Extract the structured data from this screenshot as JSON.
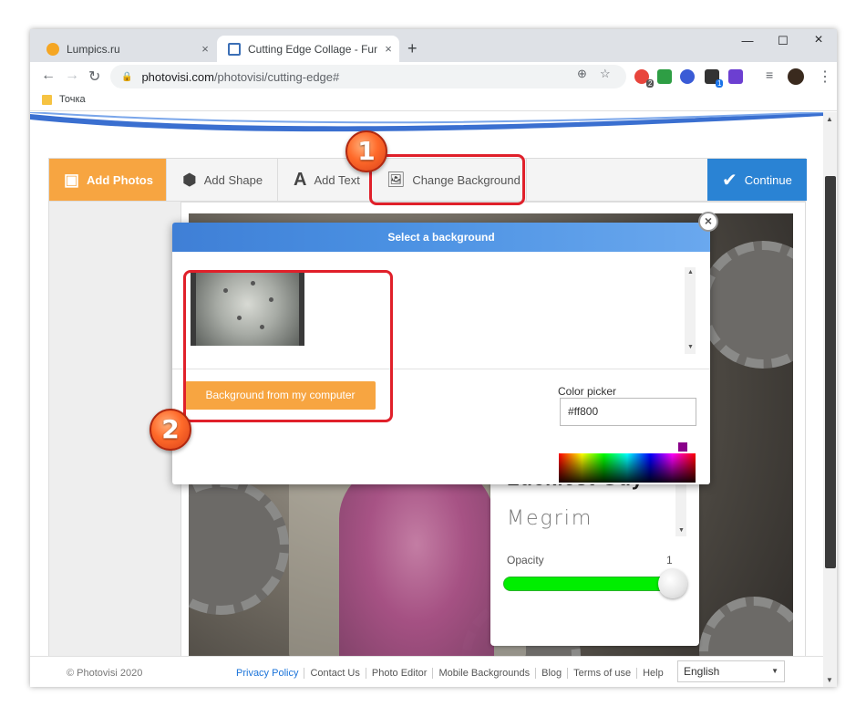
{
  "browser": {
    "tabs": [
      {
        "title": "Lumpics.ru"
      },
      {
        "title": "Cutting Edge Collage - Fun | Pho"
      }
    ],
    "url_host": "photovisi.com",
    "url_path": "/photovisi/cutting-edge#",
    "bookmark": "Точка",
    "new_tab": "+",
    "close": "×",
    "minimize": "—",
    "maximize": "☐",
    "ext_badges": [
      "2",
      "1"
    ]
  },
  "toolbar": {
    "add_photos": "Add Photos",
    "add_shape": "Add Shape",
    "add_text": "Add Text",
    "change_background": "Change Background",
    "continue": "Continue"
  },
  "dialog": {
    "title": "Select a background",
    "bg_button": "Background from my computer",
    "color_picker_label": "Color picker",
    "color_value": "#ff800",
    "close": "×"
  },
  "font_panel": {
    "font1": "Luckiest Guy",
    "font2": "Megrim",
    "opacity_label": "Opacity",
    "opacity_value": "1",
    "opacity_level": 1.0
  },
  "callouts": {
    "step1": "1",
    "step2": "2"
  },
  "footer": {
    "copyright": "© Photovisi 2020",
    "links": [
      "Privacy Policy",
      "Contact Us",
      "Photo Editor",
      "Mobile Backgrounds",
      "Blog",
      "Terms of use",
      "Help"
    ],
    "language": "English"
  },
  "colors": {
    "accent_orange": "#f7a541",
    "accent_blue": "#2a83d4",
    "callout_red": "#e0202a"
  }
}
